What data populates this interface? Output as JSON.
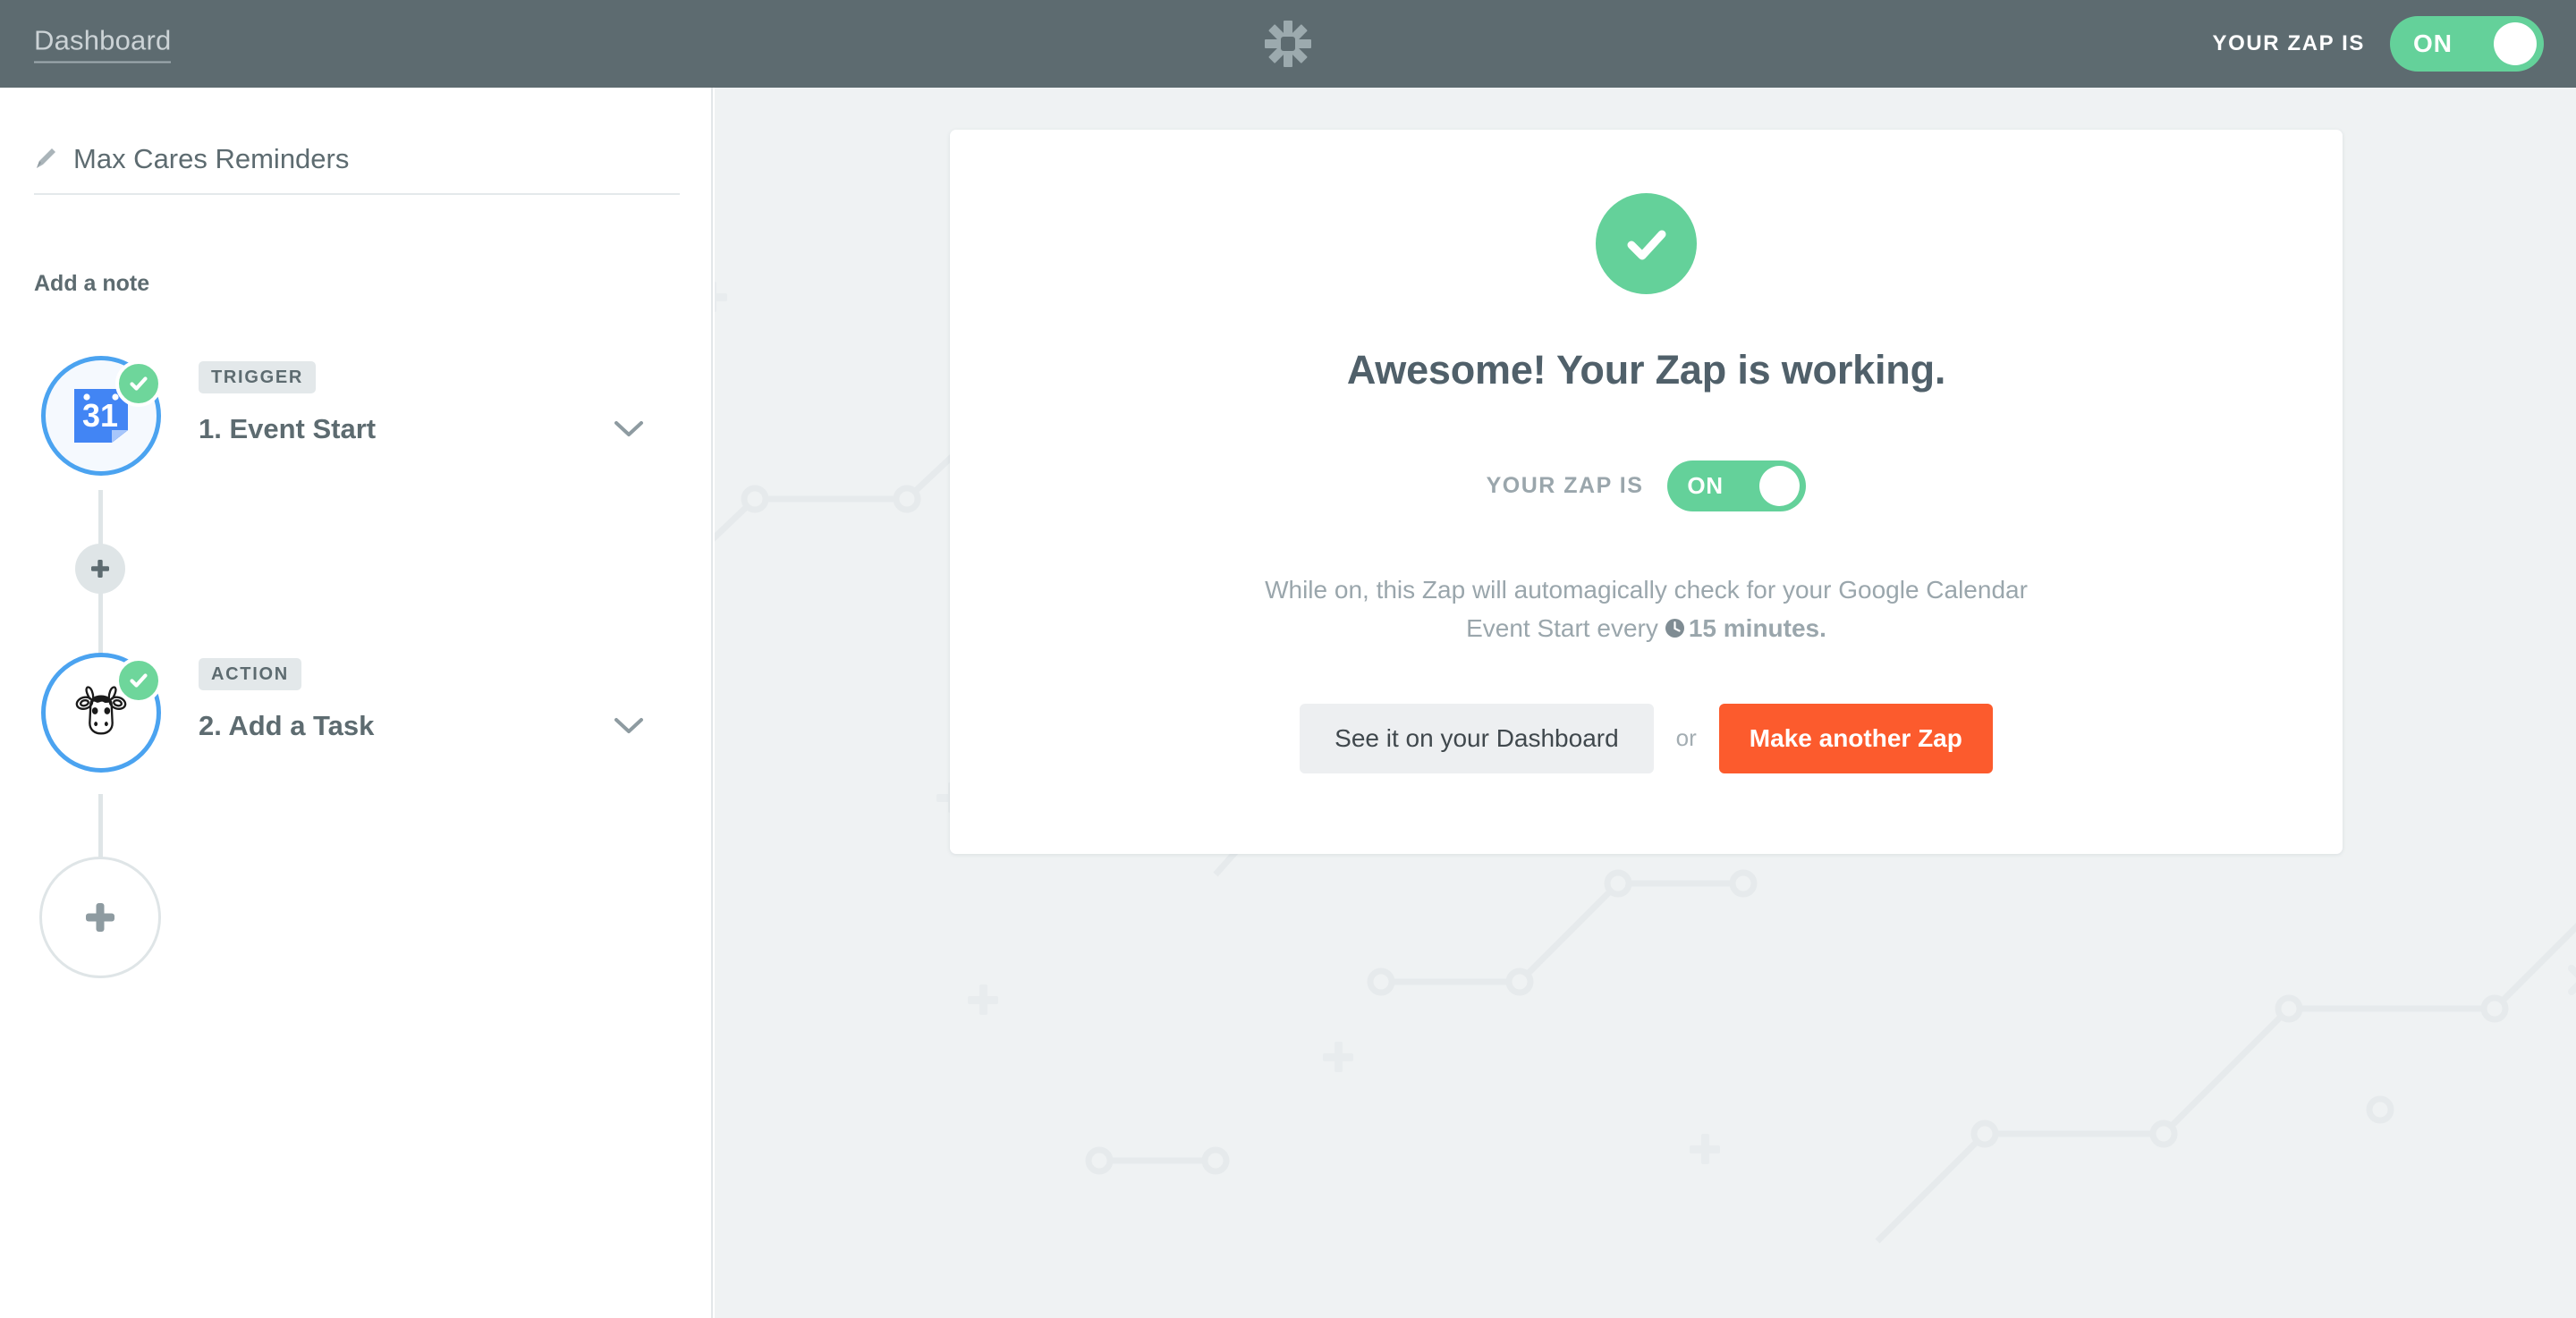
{
  "topbar": {
    "dashboard_label": "Dashboard",
    "logo_icon": "zapier-asterisk-icon",
    "zap_state_label": "YOUR ZAP IS",
    "toggle_value": "ON"
  },
  "sidebar": {
    "edit_icon": "pencil-icon",
    "zap_title": "Max Cares Reminders",
    "add_note_label": "Add a note",
    "steps": [
      {
        "kind": "TRIGGER",
        "title": "1. Event Start",
        "app_icon": "google-calendar-icon",
        "calendar_day": "31",
        "status_icon": "check-circle-icon",
        "expand_icon": "chevron-down-icon"
      },
      {
        "kind": "ACTION",
        "title": "2. Add a Task",
        "app_icon": "remember-the-milk-cow-icon",
        "status_icon": "check-circle-icon",
        "expand_icon": "chevron-down-icon"
      }
    ],
    "insert_step_icon": "plus-icon",
    "add_step_icon": "plus-icon"
  },
  "card": {
    "status_icon": "check-circle-icon",
    "headline": "Awesome! Your Zap is working.",
    "zap_state_label": "YOUR ZAP IS",
    "toggle_value": "ON",
    "description_part1": "While on, this Zap will automagically check for your Google Calendar Event Start every",
    "schedule_icon": "clock-icon",
    "description_interval": "15 minutes.",
    "secondary_button": "See it on your Dashboard",
    "separator": "or",
    "primary_button": "Make another Zap"
  },
  "colors": {
    "topbar": "#5d6b70",
    "canvas": "#eff2f3",
    "toggle_on_green": "#64d19a",
    "success_green": "#6ed69b",
    "accent_orange": "#fc5b2d",
    "node_blue": "#4ba3f0",
    "calendar_blue": "#4285f4",
    "text_slate": "#5d6b70",
    "text_muted": "#9aa6ac"
  }
}
